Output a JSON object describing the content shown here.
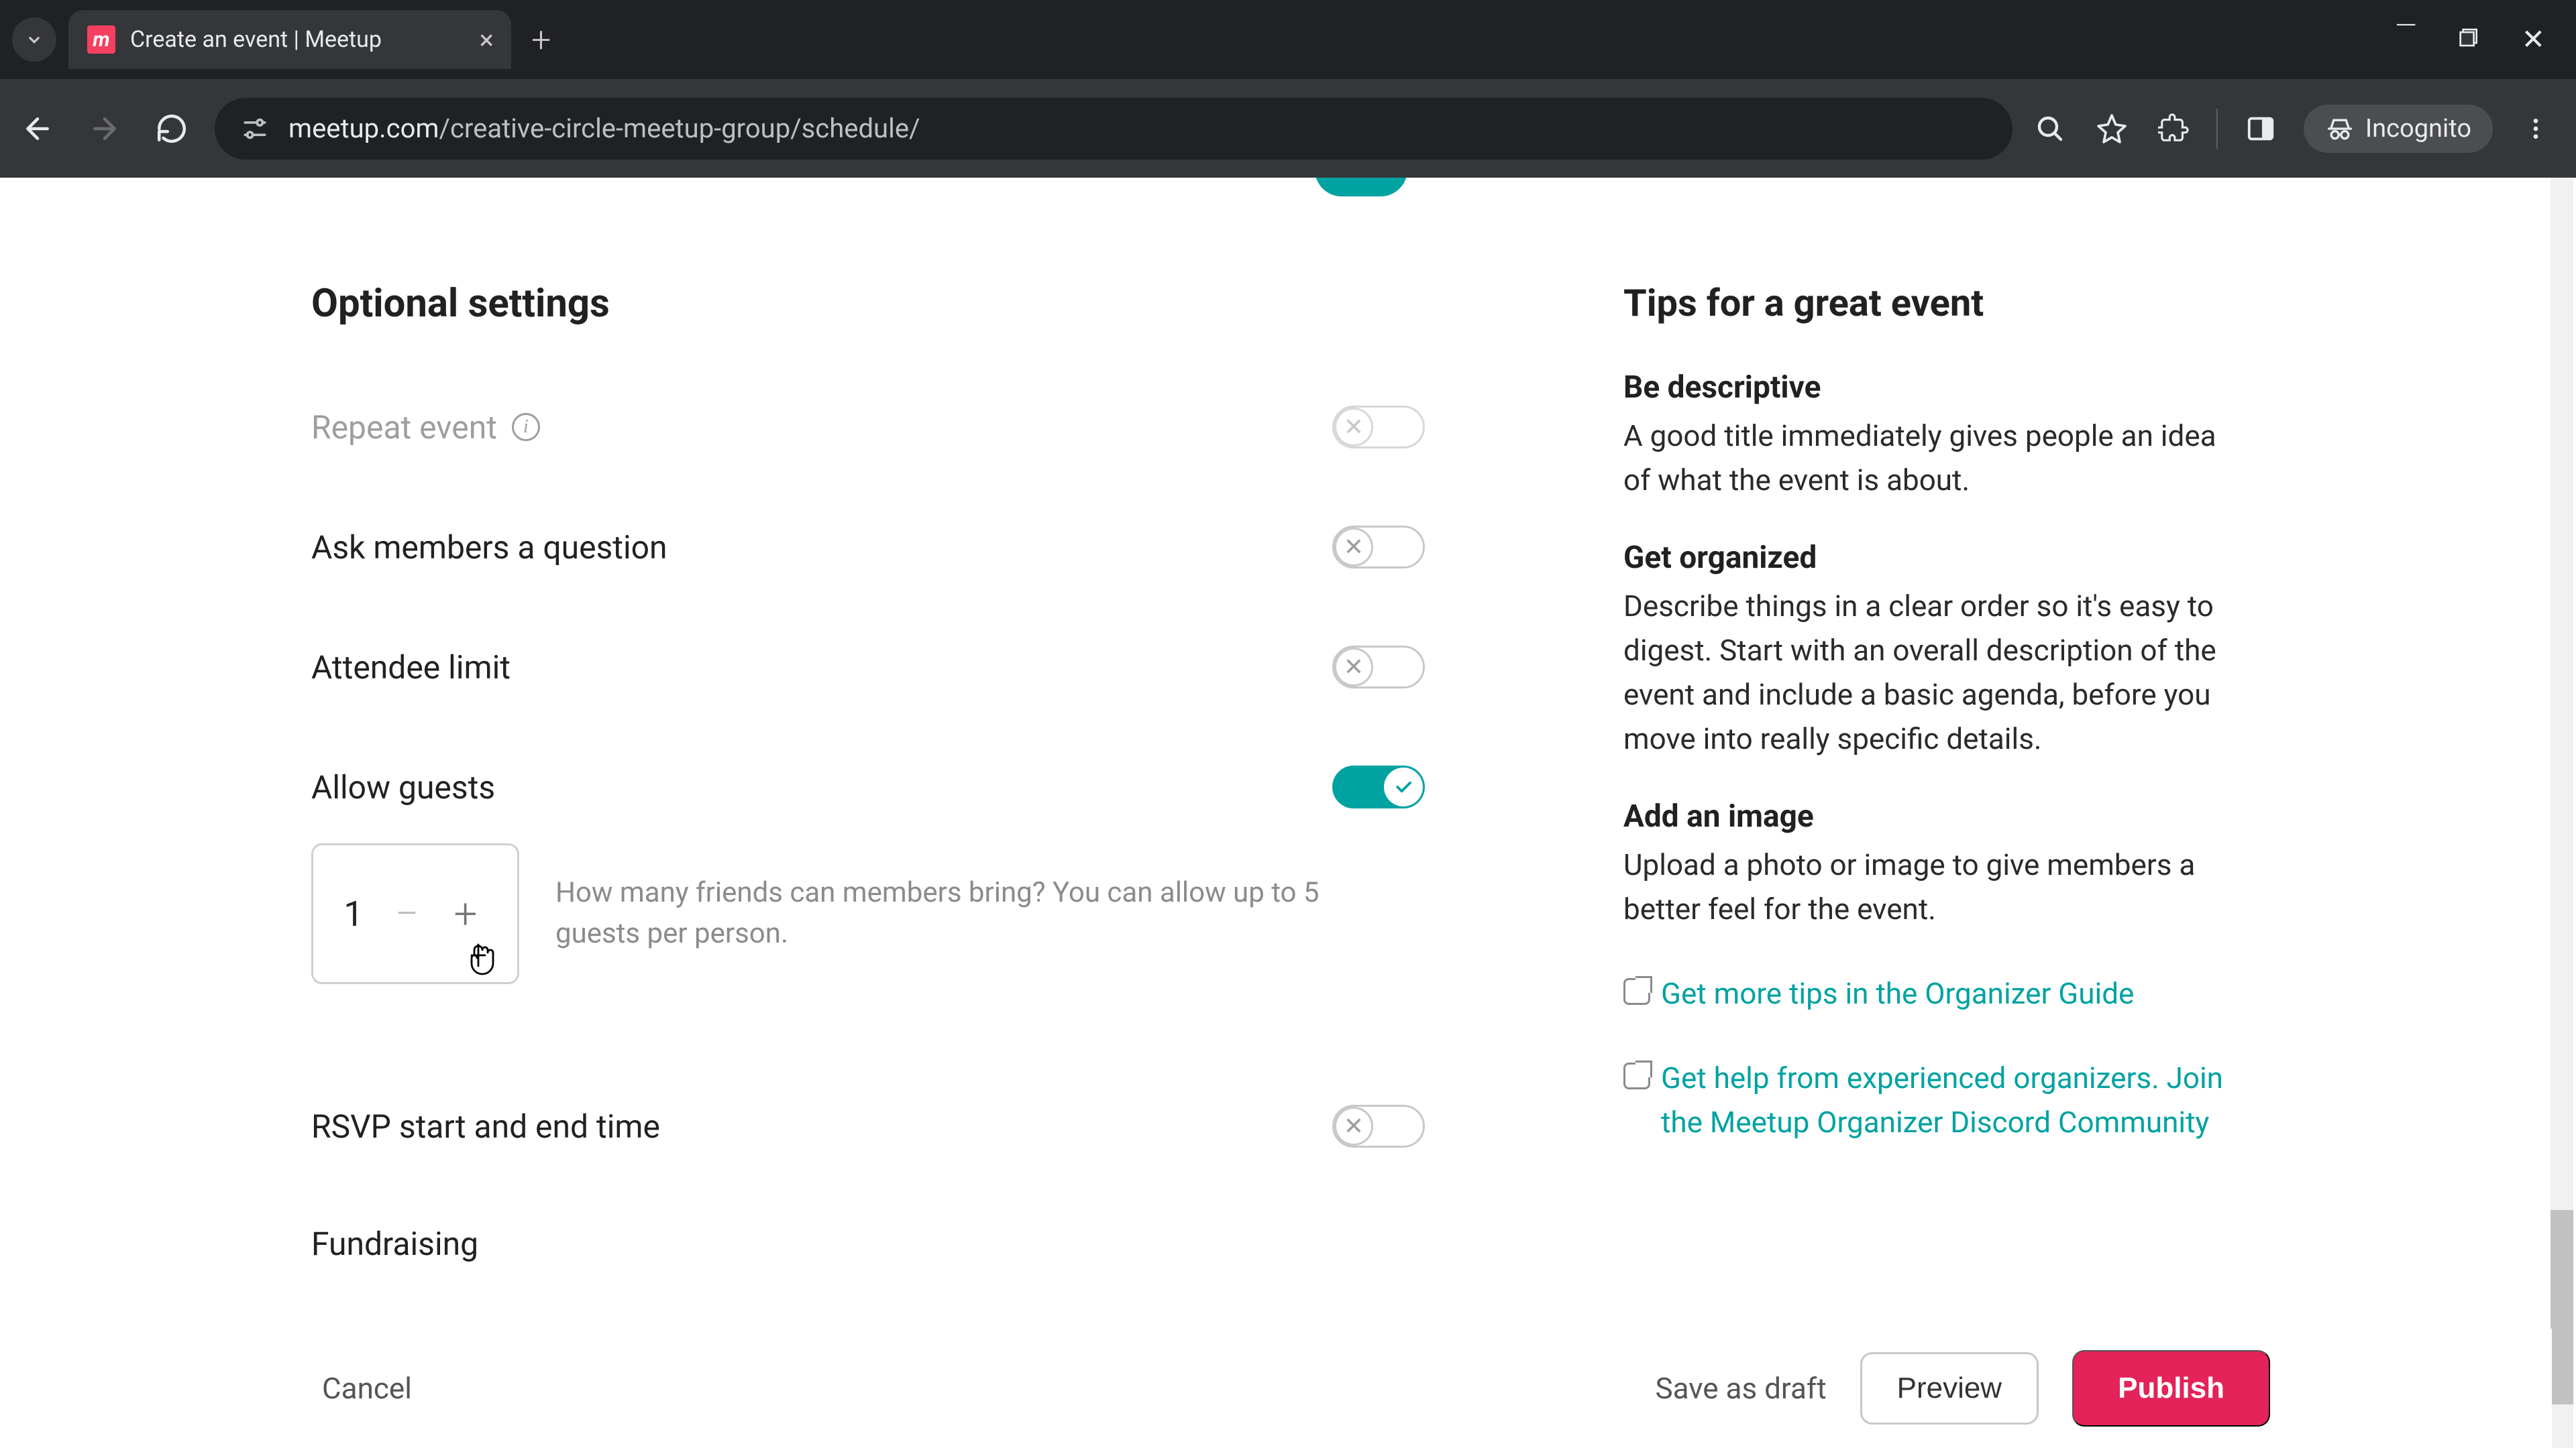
{
  "browser": {
    "tab_title": "Create an event | Meetup",
    "url_host": "meetup.com",
    "url_path": "/creative-circle-meetup-group/schedule/",
    "incognito_label": "Incognito"
  },
  "section": {
    "title": "Optional settings"
  },
  "settings": {
    "repeat_event": {
      "label": "Repeat event",
      "on": false,
      "disabled": true
    },
    "ask_question": {
      "label": "Ask members a question",
      "on": false
    },
    "attendee_limit": {
      "label": "Attendee limit",
      "on": false
    },
    "allow_guests": {
      "label": "Allow guests",
      "on": true,
      "value": "1",
      "help": "How many friends can members bring? You can allow up to 5 guests per person."
    },
    "rsvp_time": {
      "label": "RSVP start and end time",
      "on": false
    },
    "fundraising": {
      "label": "Fundraising"
    }
  },
  "tips": {
    "title": "Tips for a great event",
    "items": [
      {
        "heading": "Be descriptive",
        "body": "A good title immediately gives people an idea of what the event is about."
      },
      {
        "heading": "Get organized",
        "body": "Describe things in a clear order so it's easy to digest. Start with an overall description of the event and include a basic agenda, before you move into really specific details."
      },
      {
        "heading": "Add an image",
        "body": "Upload a photo or image to give members a better feel for the event."
      }
    ],
    "link1": "Get more tips in the Organizer Guide",
    "link2": "Get help from experienced organizers. Join the Meetup Organizer Discord Community"
  },
  "footer": {
    "cancel": "Cancel",
    "save_draft": "Save as draft",
    "preview": "Preview",
    "publish": "Publish"
  }
}
